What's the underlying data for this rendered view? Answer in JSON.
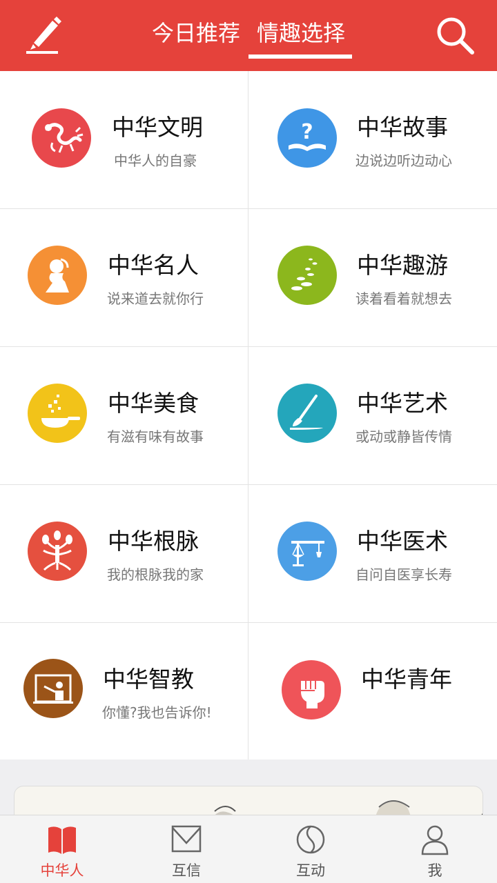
{
  "header": {
    "tabs": [
      {
        "label": "今日推荐",
        "active": false
      },
      {
        "label": "情趣选择",
        "active": true
      }
    ],
    "edit_icon": "edit-pencil-icon",
    "search_icon": "search-icon",
    "accent_color": "#e5423b"
  },
  "categories": [
    {
      "title": "中华文明",
      "subtitle": "中华人的自豪",
      "icon": "dragon-icon",
      "color": "#e8484c"
    },
    {
      "title": "中华故事",
      "subtitle": "边说边听边动心",
      "icon": "question-book-icon",
      "color": "#3f96e6"
    },
    {
      "title": "中华名人",
      "subtitle": "说来道去就你行",
      "icon": "person-silhouette-icon",
      "color": "#f59035"
    },
    {
      "title": "中华趣游",
      "subtitle": "读着看着就想去",
      "icon": "footprints-icon",
      "color": "#8cb71d"
    },
    {
      "title": "中华美食",
      "subtitle": "有滋有味有故事",
      "icon": "frying-pan-icon",
      "color": "#f2c319"
    },
    {
      "title": "中华艺术",
      "subtitle": "或动或静皆传情",
      "icon": "brush-icon",
      "color": "#24a6bb"
    },
    {
      "title": "中华根脉",
      "subtitle": "我的根脉我的家",
      "icon": "family-tree-icon",
      "color": "#e5503f"
    },
    {
      "title": "中华医术",
      "subtitle": "自问自医享长寿",
      "icon": "scale-icon",
      "color": "#4c9fe6"
    },
    {
      "title": "中华智教",
      "subtitle": "你懂?我也告诉你!",
      "icon": "teacher-board-icon",
      "color": "#9b5418"
    },
    {
      "title": "中华青年",
      "subtitle": "",
      "icon": "raised-fist-icon",
      "color": "#ef5459"
    }
  ],
  "bottom_nav": [
    {
      "label": "中华人",
      "icon": "book-icon",
      "active": true
    },
    {
      "label": "互信",
      "icon": "envelope-icon",
      "active": false
    },
    {
      "label": "互动",
      "icon": "yin-yang-icon",
      "active": false
    },
    {
      "label": "我",
      "icon": "user-icon",
      "active": false
    }
  ]
}
